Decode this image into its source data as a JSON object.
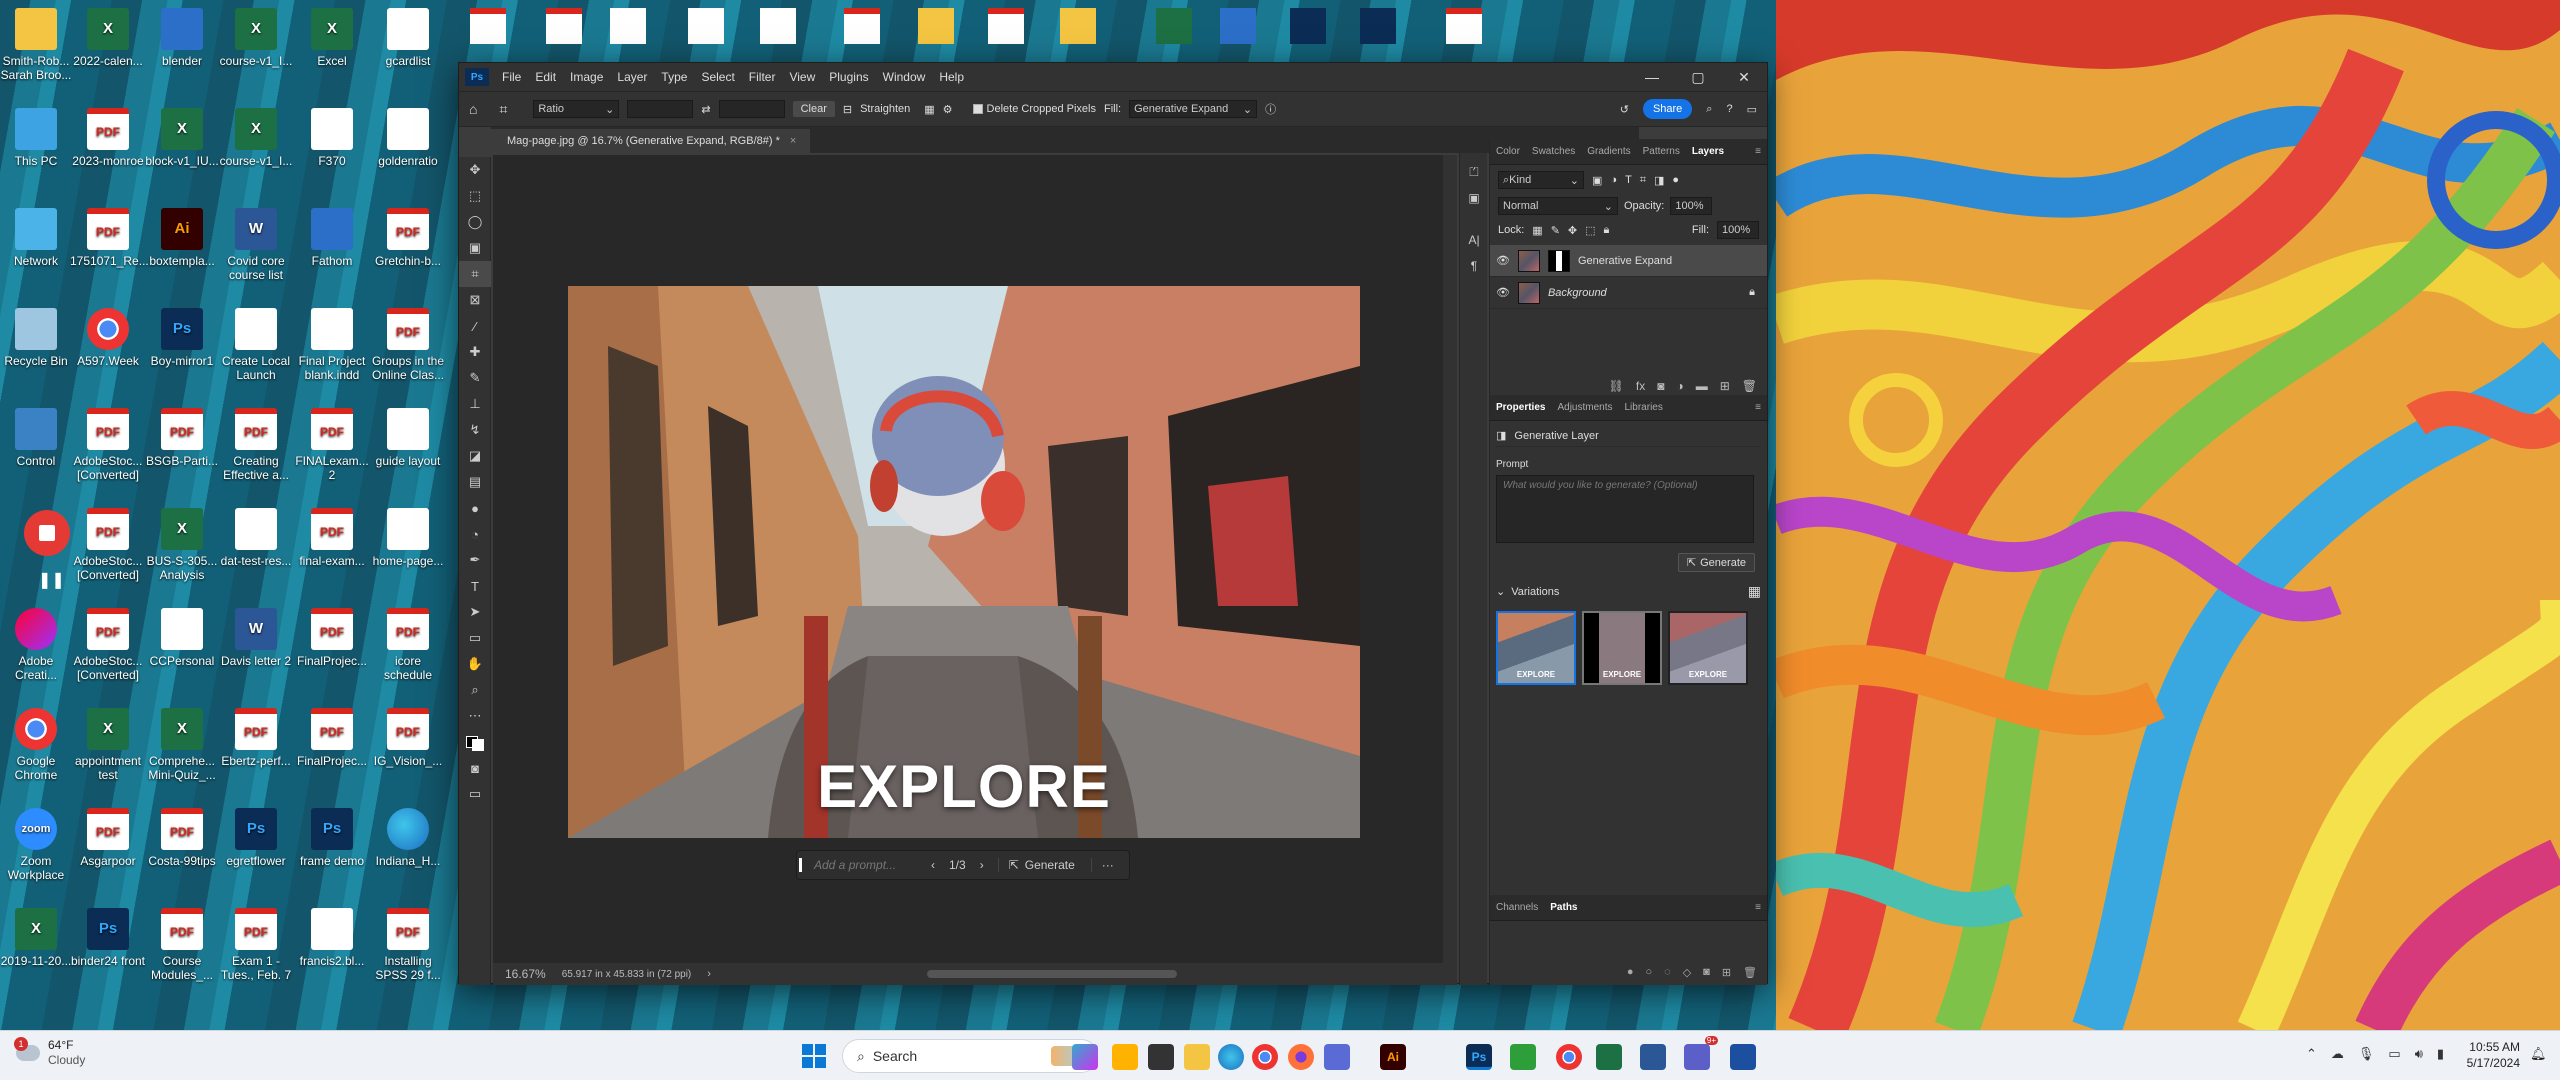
{
  "desktop_icons": [
    {
      "label": "Smith-Rob... Sarah Broo...",
      "type": "fold"
    },
    {
      "label": "2022-calen...",
      "type": "xls"
    },
    {
      "label": "blender",
      "type": "app"
    },
    {
      "label": "course-v1_I...",
      "type": "xls"
    },
    {
      "label": "Excel",
      "type": "xls"
    },
    {
      "label": "gcardlist",
      "type": "doc"
    },
    {
      "label": "This PC",
      "type": "pc"
    },
    {
      "label": "2023-monroe",
      "type": "pdf"
    },
    {
      "label": "block-v1_IU...",
      "type": "xls"
    },
    {
      "label": "course-v1_I...",
      "type": "xls"
    },
    {
      "label": "F370",
      "type": "doc"
    },
    {
      "label": "goldenratio",
      "type": "doc"
    },
    {
      "label": "Network",
      "type": "net"
    },
    {
      "label": "1751071_Re...",
      "type": "pdf"
    },
    {
      "label": "boxtempla...",
      "type": "ai"
    },
    {
      "label": "Covid core course list",
      "type": "wrd"
    },
    {
      "label": "Fathom",
      "type": "app"
    },
    {
      "label": "Gretchin-b...",
      "type": "pdf"
    },
    {
      "label": "Recycle Bin",
      "type": "bin"
    },
    {
      "label": "A597.Week",
      "type": "chr"
    },
    {
      "label": "Boy-mirror1",
      "type": "psd"
    },
    {
      "label": "Create Local Launch",
      "type": "doc"
    },
    {
      "label": "Final Project blank.indd",
      "type": "doc"
    },
    {
      "label": "Groups in the Online Clas...",
      "type": "pdf"
    },
    {
      "label": "Control",
      "type": "ctl"
    },
    {
      "label": "AdobeStoc... [Converted]",
      "type": "pdf"
    },
    {
      "label": "BSGB-Parti...",
      "type": "pdf"
    },
    {
      "label": "Creating Effective a...",
      "type": "pdf"
    },
    {
      "label": "FINALexam... 2",
      "type": "pdf"
    },
    {
      "label": "guide layout",
      "type": "doc"
    },
    {
      "label": "",
      "type": "none"
    },
    {
      "label": "AdobeStoc... [Converted]",
      "type": "pdf"
    },
    {
      "label": "BUS-S-305... Analysis",
      "type": "xls"
    },
    {
      "label": "dat-test-res...",
      "type": "doc"
    },
    {
      "label": "final-exam...",
      "type": "pdf"
    },
    {
      "label": "home-page...",
      "type": "doc"
    },
    {
      "label": "Adobe Creati...",
      "type": "cc"
    },
    {
      "label": "AdobeStoc... [Converted]",
      "type": "pdf"
    },
    {
      "label": "CCPersonal",
      "type": "doc"
    },
    {
      "label": "Davis letter 2",
      "type": "wrd"
    },
    {
      "label": "FinalProjec...",
      "type": "pdf"
    },
    {
      "label": "icore schedule",
      "type": "pdf"
    },
    {
      "label": "Google Chrome",
      "type": "chr"
    },
    {
      "label": "appointment test",
      "type": "xls"
    },
    {
      "label": "Comprehe... Mini-Quiz_...",
      "type": "xls"
    },
    {
      "label": "Ebertz-perf...",
      "type": "pdf"
    },
    {
      "label": "FinalProjec...",
      "type": "pdf"
    },
    {
      "label": "IG_Vision_...",
      "type": "pdf"
    },
    {
      "label": "Zoom Workplace",
      "type": "zoom"
    },
    {
      "label": "Asgarpoor",
      "type": "pdf"
    },
    {
      "label": "Costa-99tips",
      "type": "pdf"
    },
    {
      "label": "egretflower",
      "type": "psd"
    },
    {
      "label": "frame demo",
      "type": "psd"
    },
    {
      "label": "Indiana_H...",
      "type": "edge"
    },
    {
      "label": "2019-11-20...",
      "type": "xls"
    },
    {
      "label": "binder24 front",
      "type": "psd"
    },
    {
      "label": "Course Modules_...",
      "type": "pdf"
    },
    {
      "label": "Exam 1 - Tues., Feb. 7",
      "type": "pdf"
    },
    {
      "label": "francis2.bl...",
      "type": "doc"
    },
    {
      "label": "Installing SPSS 29 f...",
      "type": "pdf"
    }
  ],
  "ps": {
    "logo": "Ps",
    "menu": [
      "File",
      "Edit",
      "Image",
      "Layer",
      "Type",
      "Select",
      "Filter",
      "View",
      "Plugins",
      "Window",
      "Help"
    ],
    "win_controls": [
      "—",
      "▢",
      "✕"
    ],
    "options": {
      "ratio": "Ratio",
      "clear": "Clear",
      "straighten": "Straighten",
      "delete_cropped": "Delete Cropped Pixels",
      "fill_label": "Fill:",
      "fill_value": "Generative Expand",
      "share": "Share"
    },
    "doc_tab": "Mag-page.jpg @ 16.7% (Generative Expand, RGB/8#) *",
    "canvas_text": "EXPLORE",
    "genbar": {
      "placeholder": "Add a prompt...",
      "counter": "1/3",
      "generate": "Generate",
      "more": "···"
    },
    "status": {
      "zoom": "16.67%",
      "size": "65.917 in x 45.833 in (72 ppi)"
    },
    "layers_tabs": [
      "Color",
      "Swatches",
      "Gradients",
      "Patterns",
      "Layers"
    ],
    "layers_tab_active": "Layers",
    "kind": "Kind",
    "blend": "Normal",
    "opacity_label": "Opacity:",
    "opacity": "100%",
    "lock_label": "Lock:",
    "fill_label2": "Fill:",
    "fill": "100%",
    "layers": [
      {
        "name": "Generative Expand",
        "selected": true
      },
      {
        "name": "Background",
        "selected": false
      }
    ],
    "props_tabs": [
      "Properties",
      "Adjustments",
      "Libraries"
    ],
    "props_tab_active": "Properties",
    "props_layer": "Generative Layer",
    "prompt_label": "Prompt",
    "prompt_placeholder": "What would you like to generate? (Optional)",
    "generate_btn": "Generate",
    "variations_label": "Variations",
    "variation_text": "EXPLORE",
    "paths_tabs": [
      "Channels",
      "Paths"
    ],
    "paths_tab_active": "Paths"
  },
  "taskbar": {
    "weather_temp": "64°F",
    "weather_desc": "Cloudy",
    "weather_badge": "1",
    "search": "Search",
    "time": "10:55 AM",
    "date": "5/17/2024",
    "teams_badge": "9+"
  },
  "colors": {
    "ps_accent": "#1473e6",
    "recorder": "#e53935"
  }
}
